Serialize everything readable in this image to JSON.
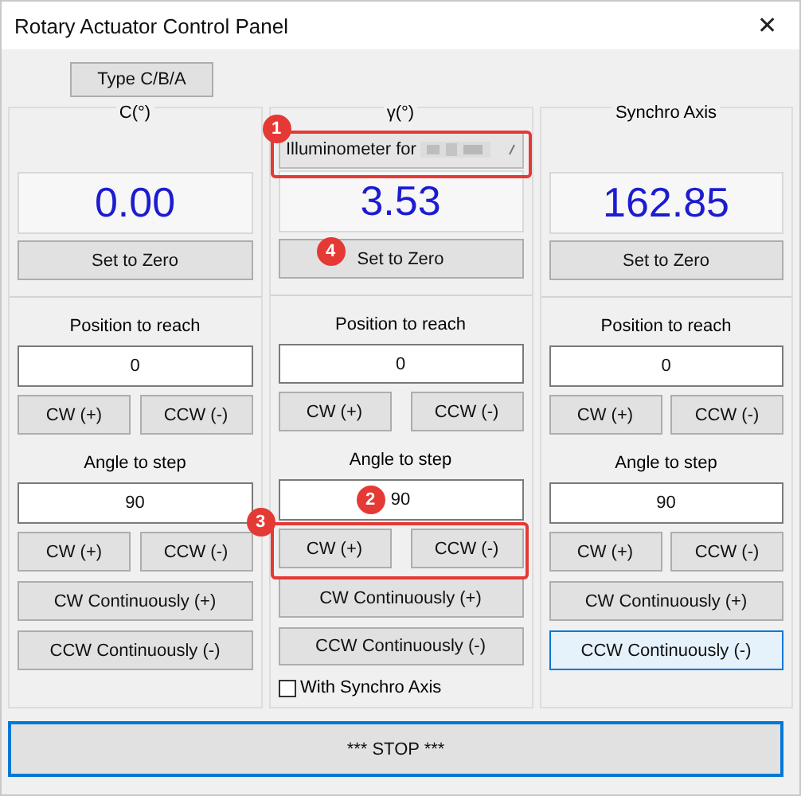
{
  "window": {
    "title": "Rotary Actuator Control Panel",
    "close": "✕"
  },
  "type_button": "Type C/B/A",
  "columns": [
    {
      "header": "C(°)",
      "reading": "0.00",
      "set_zero": {
        "label": "Set to Zero"
      },
      "position_label": "Position to reach",
      "position_value": "0",
      "position_buttons": [
        "CW  (+)",
        "CCW (-)"
      ],
      "angle_label": "Angle to step",
      "angle_value": {
        "value": "90"
      },
      "step_buttons": {
        "labels": [
          "CW  (+)",
          "CCW (-)"
        ]
      },
      "continuous_cw": {
        "label": "CW Continuously (+)",
        "focused": false
      },
      "continuous_ccw": {
        "label": "CCW Continuously (-)",
        "focused": false
      }
    },
    {
      "header": "γ(°)",
      "dropdown": {
        "label": "Illuminometer for",
        "callout": "1",
        "highlighted": true
      },
      "reading": "3.53",
      "set_zero": {
        "label": "Set to Zero",
        "callout": "4"
      },
      "position_label": "Position to reach",
      "position_value": "0",
      "position_buttons": [
        "CW  (+)",
        "CCW (-)"
      ],
      "angle_label": "Angle to step",
      "angle_value": {
        "value": "90",
        "callout": "2"
      },
      "step_buttons": {
        "labels": [
          "CW  (+)",
          "CCW (-)"
        ],
        "highlighted": true,
        "callout": "3"
      },
      "continuous_cw": {
        "label": "CW Continuously (+)",
        "focused": false
      },
      "continuous_ccw": {
        "label": "CCW Continuously (-)",
        "focused": false
      },
      "checkbox": {
        "label": "With Synchro Axis",
        "checked": false
      }
    },
    {
      "header": "Synchro Axis",
      "reading": "162.85",
      "set_zero": {
        "label": "Set to Zero"
      },
      "position_label": "Position to reach",
      "position_value": "0",
      "position_buttons": [
        "CW  (+)",
        "CCW (-)"
      ],
      "angle_label": "Angle to step",
      "angle_value": {
        "value": "90"
      },
      "step_buttons": {
        "labels": [
          "CW  (+)",
          "CCW (-)"
        ]
      },
      "continuous_cw": {
        "label": "CW Continuously (+)",
        "focused": false
      },
      "continuous_ccw": {
        "label": "CCW Continuously (-)",
        "focused": true
      }
    }
  ],
  "stop_button": "*** STOP ***"
}
